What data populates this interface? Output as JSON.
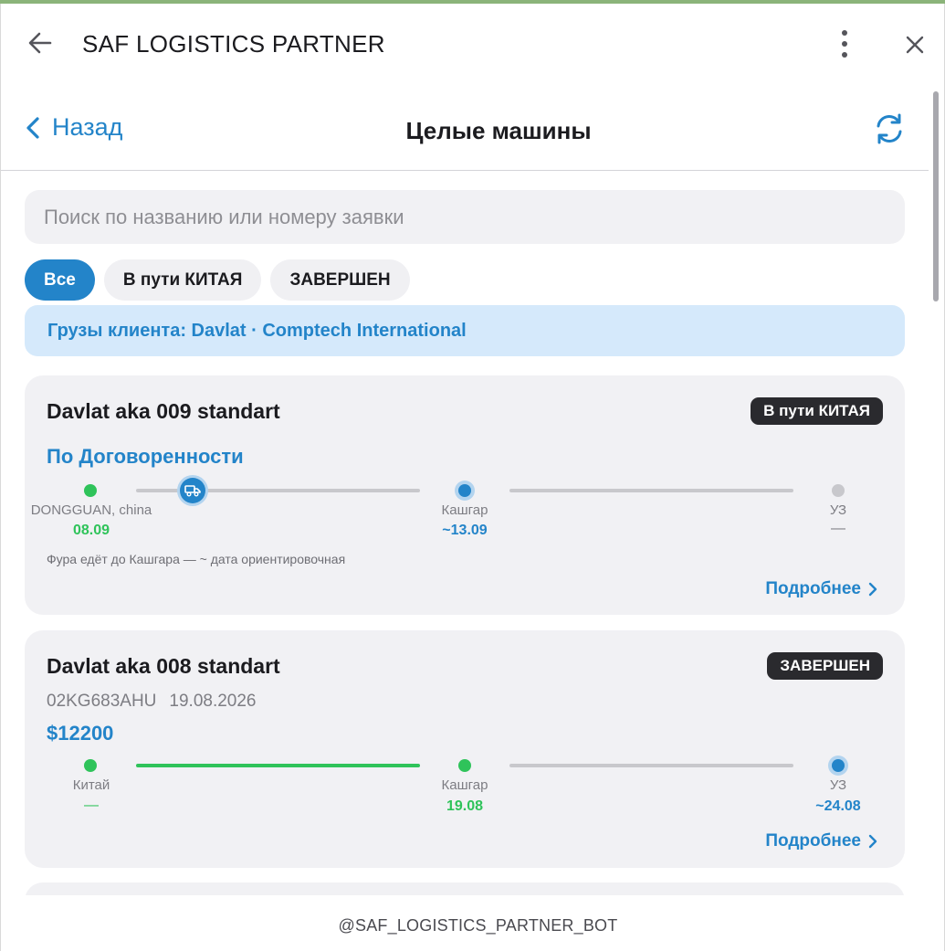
{
  "window": {
    "title": "SAF LOGISTICS PARTNER"
  },
  "header": {
    "back_label": "Назад",
    "title": "Целые машины"
  },
  "search": {
    "placeholder": "Поиск по названию или номеру заявки"
  },
  "filters": [
    {
      "label": "Все",
      "active": true
    },
    {
      "label": "В пути КИТАЯ",
      "active": false
    },
    {
      "label": "ЗАВЕРШЕН",
      "active": false
    }
  ],
  "client_banner": "Грузы клиента: Davlat · Comptech International",
  "cards": [
    {
      "title": "Davlat aka 009 standart",
      "status": "В пути КИТАЯ",
      "price": "По Договоренности",
      "stops": [
        {
          "name": "DONGGUAN, china",
          "date": "08.09"
        },
        {
          "name": "Кашгар",
          "date": "~13.09"
        },
        {
          "name": "УЗ",
          "date": "—"
        }
      ],
      "truck_progress": 0.2,
      "note": "Фура едёт до Кашгара — ~ дата ориентировочная",
      "details_label": "Подробнее"
    },
    {
      "title": "Davlat aka 008 standart",
      "status": "ЗАВЕРШЕН",
      "plate": "02KG683AHU",
      "date": "19.08.2026",
      "price": "$12200",
      "stops": [
        {
          "name": "Китай",
          "date": "—"
        },
        {
          "name": "Кашгар",
          "date": "19.08"
        },
        {
          "name": "УЗ",
          "date": "~24.08"
        }
      ],
      "details_label": "Подробнее"
    }
  ],
  "footer": "@SAF_LOGISTICS_PARTNER_BOT",
  "colors": {
    "accent": "#2384c9",
    "success": "#2fc35a",
    "badge": "#2a2a2e",
    "card": "#f1f1f4"
  }
}
